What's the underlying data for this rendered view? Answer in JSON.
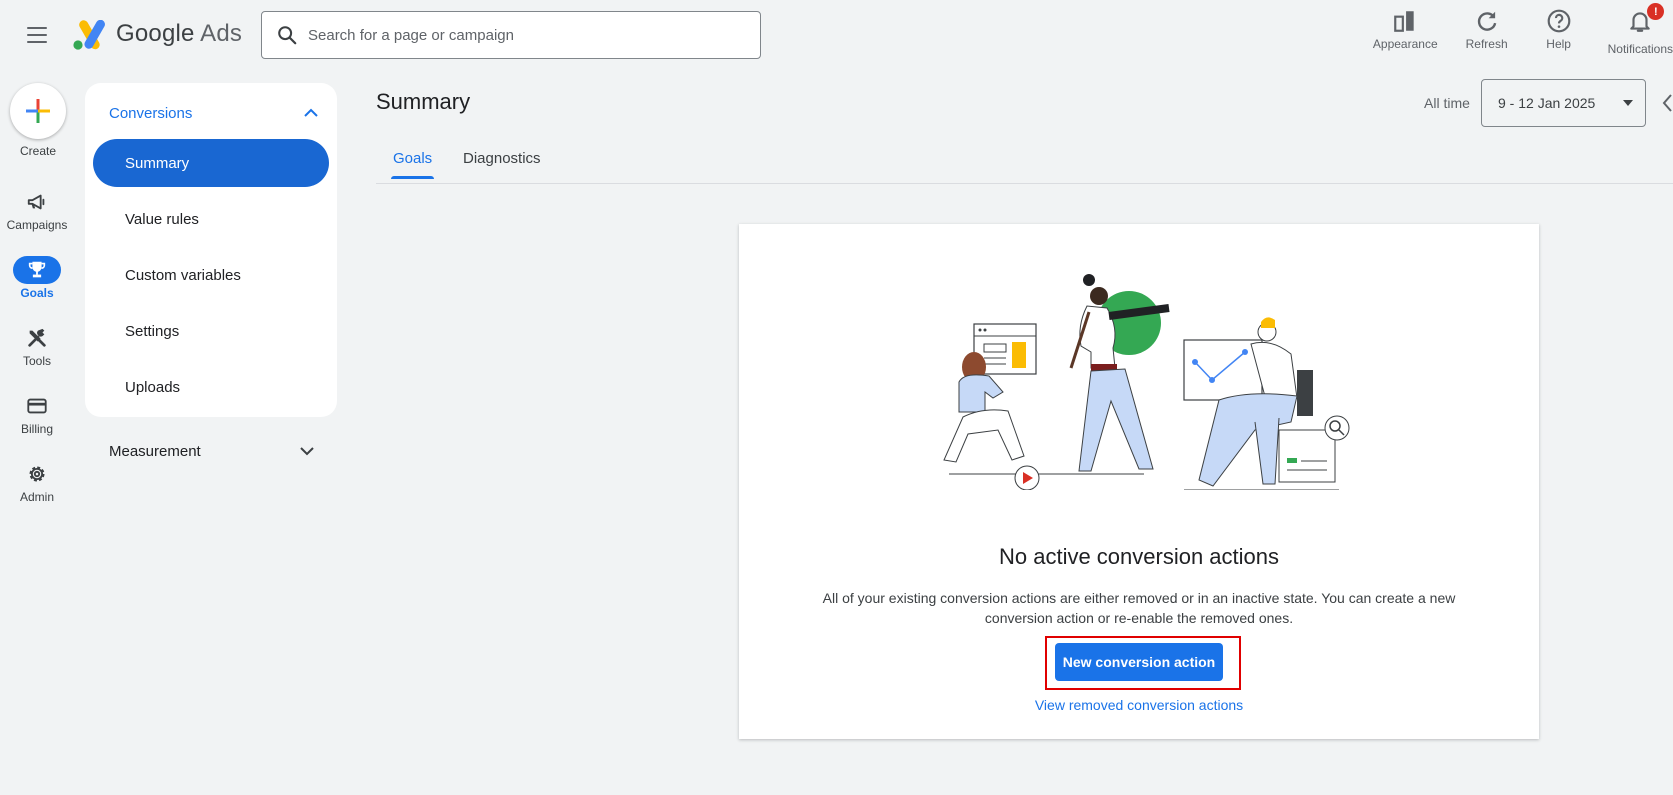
{
  "header": {
    "brand_google": "Google",
    "brand_ads": "Ads",
    "search_placeholder": "Search for a page or campaign",
    "actions": [
      {
        "label": "Appearance",
        "icon": "appearance-icon"
      },
      {
        "label": "Refresh",
        "icon": "refresh-icon"
      },
      {
        "label": "Help",
        "icon": "help-icon"
      },
      {
        "label": "Notifications",
        "icon": "bell-icon",
        "badge": "!"
      }
    ]
  },
  "rail": {
    "create_label": "Create",
    "items": [
      {
        "label": "Campaigns",
        "icon": "megaphone-icon"
      },
      {
        "label": "Goals",
        "icon": "trophy-icon",
        "active": true
      },
      {
        "label": "Tools",
        "icon": "tools-icon"
      },
      {
        "label": "Billing",
        "icon": "credit-card-icon"
      },
      {
        "label": "Admin",
        "icon": "gear-icon"
      }
    ]
  },
  "section_nav": {
    "header": "Conversions",
    "items": [
      {
        "label": "Summary",
        "active": true
      },
      {
        "label": "Value rules"
      },
      {
        "label": "Custom variables"
      },
      {
        "label": "Settings"
      },
      {
        "label": "Uploads"
      }
    ],
    "measurement": "Measurement"
  },
  "main": {
    "title": "Summary",
    "date_range_label": "All time",
    "date_range": "9 - 12 Jan 2025",
    "tabs": [
      {
        "label": "Goals",
        "active": true
      },
      {
        "label": "Diagnostics"
      }
    ],
    "empty_state": {
      "title": "No active conversion actions",
      "description": "All of your existing conversion actions are either removed or in an inactive state. You can create a new conversion action or re-enable the removed ones.",
      "primary_button": "New conversion action",
      "link": "View removed conversion actions"
    }
  },
  "colors": {
    "accent": "#1a73e8",
    "background": "#f1f3f4",
    "highlight_box": "#e00000",
    "notification_badge": "#d93025"
  }
}
